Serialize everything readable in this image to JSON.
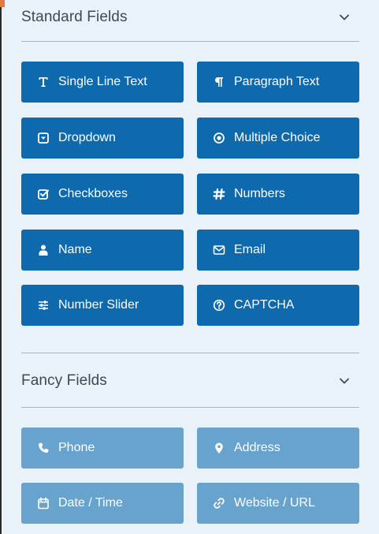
{
  "standard": {
    "title": "Standard Fields",
    "chevron_icon": "chevron-down-icon",
    "buttons": [
      {
        "label": "Single Line Text",
        "icon": "text-icon"
      },
      {
        "label": "Paragraph Text",
        "icon": "paragraph-icon"
      },
      {
        "label": "Dropdown",
        "icon": "dropdown-icon"
      },
      {
        "label": "Multiple Choice",
        "icon": "radio-icon"
      },
      {
        "label": "Checkboxes",
        "icon": "checkbox-icon"
      },
      {
        "label": "Numbers",
        "icon": "hash-icon"
      },
      {
        "label": "Name",
        "icon": "user-icon"
      },
      {
        "label": "Email",
        "icon": "envelope-icon"
      },
      {
        "label": "Number Slider",
        "icon": "sliders-icon"
      },
      {
        "label": "CAPTCHA",
        "icon": "question-circle-icon"
      }
    ]
  },
  "fancy": {
    "title": "Fancy Fields",
    "chevron_icon": "chevron-down-icon",
    "buttons": [
      {
        "label": "Phone",
        "icon": "phone-icon"
      },
      {
        "label": "Address",
        "icon": "map-marker-icon"
      },
      {
        "label": "Date / Time",
        "icon": "calendar-icon"
      },
      {
        "label": "Website / URL",
        "icon": "link-icon"
      }
    ]
  },
  "colors": {
    "background": "#e9f1f9",
    "standard_button": "#0e6aad",
    "fancy_button": "#67a3cd",
    "title_text": "#3b4a57",
    "divider": "#a9b5c2"
  }
}
